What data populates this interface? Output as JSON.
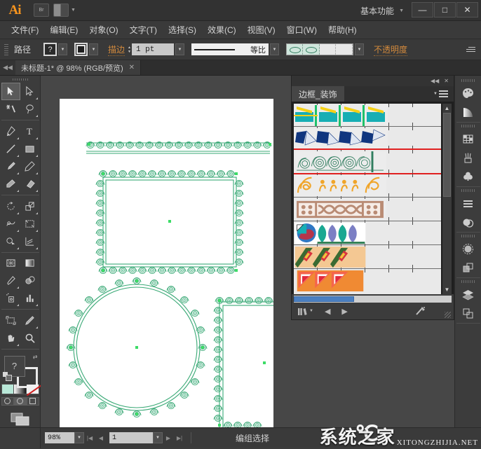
{
  "titlebar": {
    "app": "Ai",
    "bridge_label": "Br",
    "arrange_label": "",
    "workspace": "基本功能",
    "minimize": "—",
    "maximize": "□",
    "close": "✕"
  },
  "menubar": {
    "items": [
      "文件(F)",
      "编辑(E)",
      "对象(O)",
      "文字(T)",
      "选择(S)",
      "效果(C)",
      "视图(V)",
      "窗口(W)",
      "帮助(H)"
    ]
  },
  "controlbar": {
    "object_label": "路径",
    "fill_symbol": "?",
    "stroke_label": "描边",
    "stroke_weight": "1 pt",
    "stroke_profile": "等比",
    "opacity_label": "不透明度"
  },
  "tabbar": {
    "document_tab": "未标题-1* @ 98% (RGB/预览)",
    "close_glyph": "✕"
  },
  "toolbox": {
    "tools": [
      {
        "name": "selection-tool",
        "active": true
      },
      {
        "name": "direct-selection-tool",
        "active": false
      },
      {
        "name": "magic-wand-tool",
        "active": false
      },
      {
        "name": "lasso-tool",
        "active": false
      },
      {
        "name": "pen-tool",
        "active": false
      },
      {
        "name": "type-tool",
        "active": false
      },
      {
        "name": "line-segment-tool",
        "active": false
      },
      {
        "name": "rectangle-tool",
        "active": false
      },
      {
        "name": "paintbrush-tool",
        "active": false
      },
      {
        "name": "pencil-tool",
        "active": false
      },
      {
        "name": "blob-brush-tool",
        "active": false
      },
      {
        "name": "eraser-tool",
        "active": false
      },
      {
        "name": "rotate-tool",
        "active": false
      },
      {
        "name": "scale-tool",
        "active": false
      },
      {
        "name": "width-tool",
        "active": false
      },
      {
        "name": "free-transform-tool",
        "active": false
      },
      {
        "name": "shape-builder-tool",
        "active": false
      },
      {
        "name": "perspective-grid-tool",
        "active": false
      },
      {
        "name": "mesh-tool",
        "active": false
      },
      {
        "name": "gradient-tool",
        "active": false
      },
      {
        "name": "eyedropper-tool",
        "active": false
      },
      {
        "name": "blend-tool",
        "active": false
      },
      {
        "name": "symbol-sprayer-tool",
        "active": false
      },
      {
        "name": "column-graph-tool",
        "active": false
      },
      {
        "name": "artboard-tool",
        "active": false
      },
      {
        "name": "slice-tool",
        "active": false
      },
      {
        "name": "hand-tool",
        "active": false
      },
      {
        "name": "zoom-tool",
        "active": false
      }
    ],
    "fill_symbol": "?",
    "swap_glyph": "⇄",
    "color_modes": [
      "color-swatch",
      "gradient-swatch",
      "none-swatch"
    ],
    "screen_modes": [
      "normal-screen-mode",
      "full-screen-menu-mode",
      "full-screen-mode"
    ]
  },
  "pattern_panel": {
    "collapse_glyph": "◀◀",
    "close_glyph": "✕",
    "tab_title": "边框_装饰",
    "menu_glyph": "≡",
    "swatch_rows": [
      {
        "name": "teal-yellow-stripe-pattern",
        "selected": false
      },
      {
        "name": "blue-chevron-fan-pattern",
        "selected": false
      },
      {
        "name": "green-scroll-ornament-pattern",
        "selected": true
      },
      {
        "name": "orange-filigree-pattern",
        "selected": false
      },
      {
        "name": "brown-braid-rope-pattern",
        "selected": false
      },
      {
        "name": "teal-violet-leaf-pattern",
        "selected": false
      },
      {
        "name": "green-diagonal-stripe-pattern",
        "selected": false
      },
      {
        "name": "orange-triangle-quilt-pattern",
        "selected": false
      }
    ],
    "footer": {
      "library_label": "",
      "prev_glyph": "◀",
      "next_glyph": "▶",
      "delete_glyph": "✘"
    }
  },
  "dock": {
    "groups": [
      [
        "color-panel-icon",
        "gradient-panel-icon"
      ],
      [
        "swatches-panel-icon",
        "brushes-panel-icon",
        "symbols-panel-icon"
      ],
      [
        "stroke-panel-icon",
        "transparency-panel-icon"
      ],
      [
        "appearance-panel-icon",
        "pathfinder-panel-icon"
      ],
      [
        "layers-panel-icon",
        "artboards-panel-icon"
      ]
    ]
  },
  "statusbar": {
    "zoom": "98%",
    "page": "1",
    "first_glyph": "|◀",
    "prev_glyph": "◀",
    "next_glyph": "▶",
    "last_glyph": "▶|",
    "status_text": "编组选择"
  },
  "watermark": {
    "cn": "系统之家",
    "en": "XITONGZHIJIA.NET"
  },
  "colors": {
    "accent_orange": "#d38a3c",
    "app_logo": "#f7941e",
    "selection_red": "#e02020",
    "artwork_green": "#3aa976",
    "anchor_green": "#3ddc67",
    "panel_bg": "#3c3c3c",
    "canvas_bg": "#474747"
  }
}
